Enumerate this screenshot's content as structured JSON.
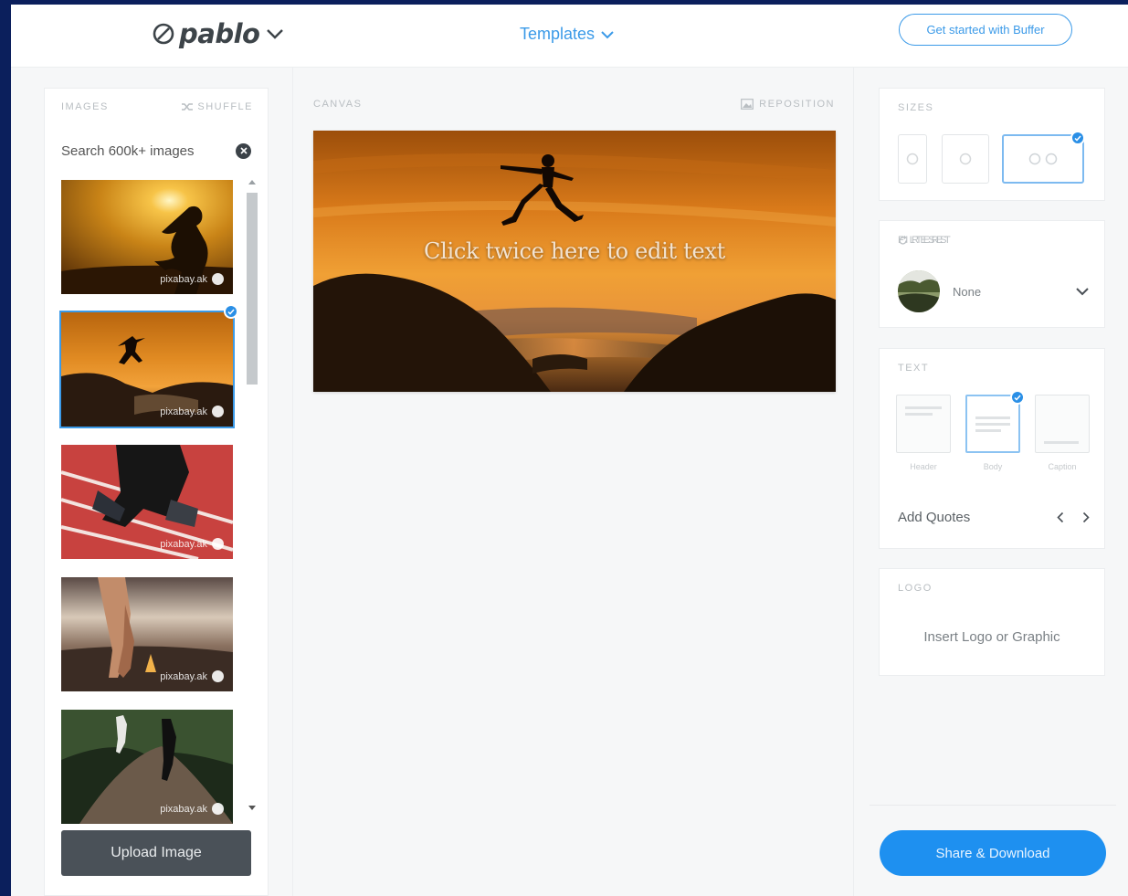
{
  "header": {
    "logo_text": "pablo",
    "templates_label": "Templates",
    "get_started_label": "Get started with Buffer"
  },
  "images_panel": {
    "section_label": "IMAGES",
    "shuffle_label": "SHUFFLE",
    "search_placeholder": "Search 600k+ images",
    "thumbnails": [
      {
        "credit": "pixabay.ak",
        "selected": false
      },
      {
        "credit": "pixabay.ak",
        "selected": true
      },
      {
        "credit": "pixabay.ak",
        "selected": false
      },
      {
        "credit": "pixabay.ak",
        "selected": false
      },
      {
        "credit": "pixabay.ak",
        "selected": false
      }
    ],
    "upload_label": "Upload Image"
  },
  "canvas_panel": {
    "section_label": "CANVAS",
    "reposition_label": "REPOSITION",
    "overlay_text": "Click twice here to edit text"
  },
  "sizes_panel": {
    "section_label": "SIZES",
    "selected_index": 2
  },
  "filters_panel": {
    "section_label": "FILTERS",
    "reset_label": "RESET",
    "current_filter": "None"
  },
  "text_panel": {
    "section_label": "TEXT",
    "options": [
      "Header",
      "Body",
      "Caption"
    ],
    "selected_index": 1,
    "add_quotes_label": "Add Quotes"
  },
  "logo_panel": {
    "section_label": "LOGO",
    "insert_label": "Insert Logo or Graphic"
  },
  "share_label": "Share & Download",
  "colors": {
    "accent": "#1e90f0",
    "link_blue": "#3b9ae8",
    "upload_button": "#4a5158",
    "frame": "#0b1f5c"
  }
}
